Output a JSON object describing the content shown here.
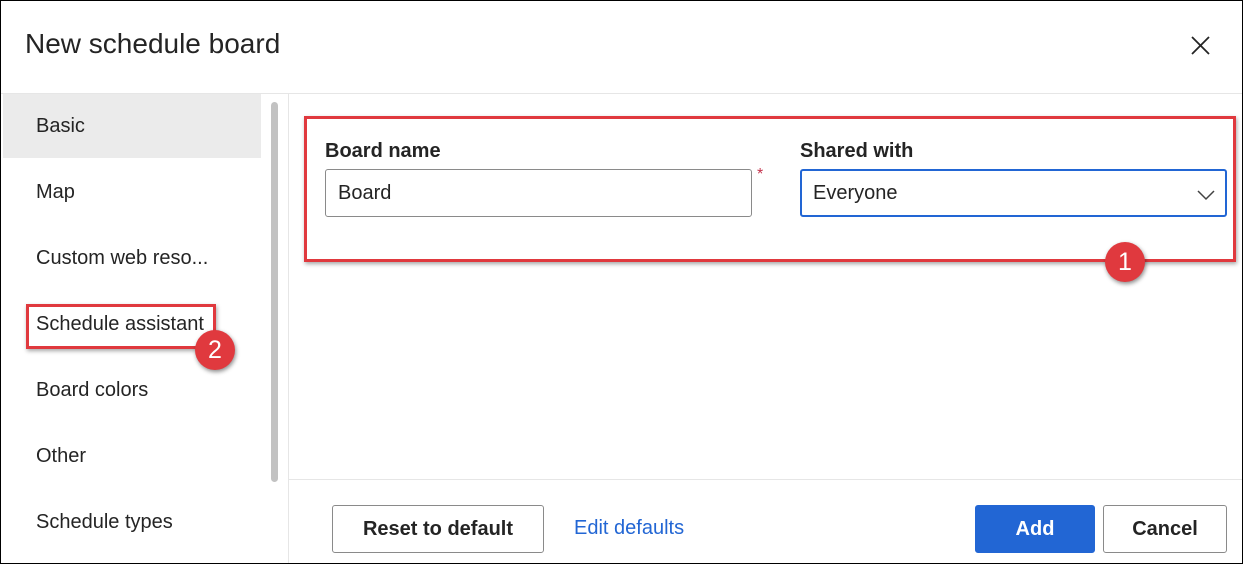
{
  "dialog": {
    "title": "New schedule board",
    "close_icon": "close-icon"
  },
  "sidebar": {
    "items": [
      {
        "label": "Basic",
        "active": true
      },
      {
        "label": "Map"
      },
      {
        "label": "Custom web reso..."
      },
      {
        "label": "Schedule assistant"
      },
      {
        "label": "Board colors"
      },
      {
        "label": "Other"
      },
      {
        "label": "Schedule types",
        "icon": "chevron-down-icon"
      }
    ]
  },
  "form": {
    "board_name_label": "Board name",
    "board_name_value": "Board",
    "required_marker": "*",
    "shared_with_label": "Shared with",
    "shared_with_value": "Everyone"
  },
  "annotations": {
    "badge_1": "1",
    "badge_2": "2",
    "color": "#e0393e"
  },
  "footer": {
    "reset_label": "Reset to default",
    "edit_defaults_label": "Edit defaults",
    "add_label": "Add",
    "cancel_label": "Cancel"
  },
  "colors": {
    "accent": "#2266d4",
    "active_nav": "#ebebeb",
    "required": "#c4314b"
  }
}
